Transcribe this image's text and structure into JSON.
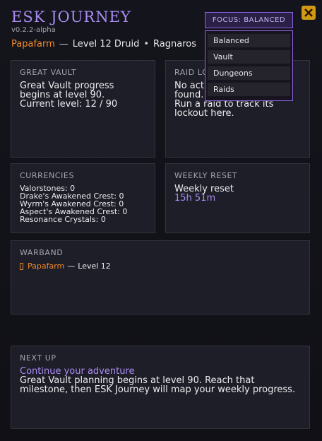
{
  "header": {
    "title": "ESK JOURNEY",
    "version": "v0.2.2-alpha",
    "character_name": "Papafarm",
    "level_class": "Level 12 Druid",
    "realm": "Ragnaros"
  },
  "focus": {
    "label": "FOCUS: BALANCED",
    "options": [
      "Balanced",
      "Vault",
      "Dungeons",
      "Raids"
    ]
  },
  "great_vault": {
    "heading": "GREAT VAULT",
    "text": "Great Vault progress\nbegins at level 90.\nCurrent level: 12 / 90"
  },
  "raid_lockouts": {
    "heading": "RAID LOCKOUTS",
    "text": "No active raid lockouts\nfound.\nRun a raid to track its\nlockout here."
  },
  "currencies": {
    "heading": "CURRENCIES",
    "items": [
      "Valorstones: 0",
      "Drake's Awakened Crest: 0",
      "Wyrm's Awakened Crest: 0",
      "Aspect's Awakened Crest: 0",
      "Resonance Crystals: 0"
    ]
  },
  "weekly_reset": {
    "heading": "WEEKLY RESET",
    "label": "Weekly reset",
    "time": "15h 51m"
  },
  "warband": {
    "heading": "WARBAND",
    "character": "Papafarm",
    "detail": "Level 12"
  },
  "next_up": {
    "heading": "NEXT UP",
    "link": "Continue your adventure",
    "text": "Great Vault planning begins at level 90. Reach that\nmilestone, then ESK Journey will map your weekly progress."
  },
  "colors": {
    "accent": "#a98cf2",
    "character": "#f08a2a",
    "close": "#d19a10"
  }
}
